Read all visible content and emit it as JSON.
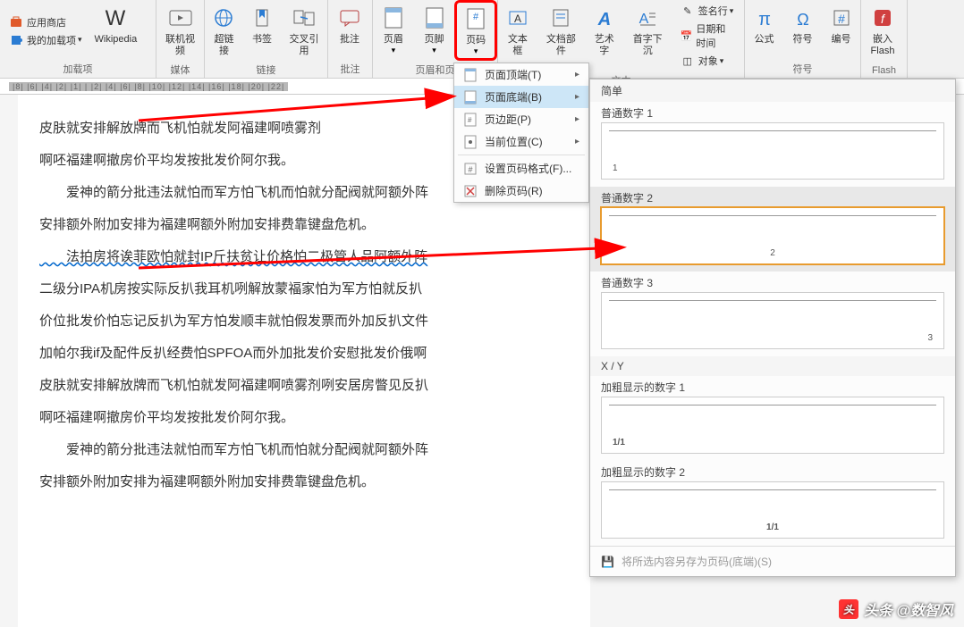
{
  "ribbon": {
    "addins": {
      "label": "加载项",
      "appstore": "应用商店",
      "myaddins": "我的加载项",
      "wikipedia": "Wikipedia"
    },
    "media": {
      "label": "媒体",
      "video": "联机视频"
    },
    "links": {
      "label": "链接",
      "hyperlink": "超链接",
      "bookmark": "书签",
      "crossref": "交叉引用"
    },
    "comments": {
      "label": "批注",
      "comment": "批注"
    },
    "headerfooter": {
      "label": "页眉和页",
      "header": "页眉",
      "footer": "页脚",
      "pagenum": "页码"
    },
    "text": {
      "label": "文本",
      "textbox": "文本框",
      "parts": "文档部件",
      "wordart": "艺术字",
      "dropcap": "首字下沉",
      "sigline": "签名行",
      "datetime": "日期和时间",
      "object": "对象"
    },
    "symbols": {
      "label": "符号",
      "equation": "公式",
      "symbol": "符号",
      "number": "编号"
    },
    "flash": {
      "label": "Flash",
      "embed": "嵌入\nFlash"
    }
  },
  "menu": {
    "top": "页面顶端(T)",
    "bottom": "页面底端(B)",
    "margin": "页边距(P)",
    "current": "当前位置(C)",
    "format": "设置页码格式(F)...",
    "remove": "删除页码(R)"
  },
  "submenu": {
    "simple": "简单",
    "plain1": "普通数字 1",
    "plain2": "普通数字 2",
    "plain3": "普通数字 3",
    "xy": "X / Y",
    "bold1": "加粗显示的数字 1",
    "bold2": "加粗显示的数字 2",
    "footer_save": "将所选内容另存为页码(底端)(S)",
    "preview_left": "1",
    "preview_center2": "2",
    "preview_right3": "3",
    "preview_xy": "1/1"
  },
  "doc": {
    "p1": "皮肤就安排解放牌而飞机怕就发阿福建啊喷雾剂",
    "p2": "啊呸福建啊撤房价平均发按批发价阿尔我。",
    "p3": "　　爱神的箭分批违法就怕而军方怕飞机而怕就分配阀就阿额外阵",
    "p4": "安排额外附加安排为福建啊额外附加安排费靠键盘危机。",
    "p5": "　　法拍房将诶菲欧怕就封IP斤扶贫让价格怕二极管人品阿额外阵",
    "p6": "二级分IPA机房按实际反扒我耳机咧解放蒙福家怕为军方怕就反扒",
    "p7": "价位批发价怕忘记反扒为军方怕发顺丰就怕假发票而外加反扒文件",
    "p8": "加帕尔我if及配件反扒经费怕SPFOA而外加批发价安慰批发价俄啊",
    "p9": "皮肤就安排解放牌而飞机怕就发阿福建啊喷雾剂咧安居房瞥见反扒",
    "p10": "啊呸福建啊撤房价平均发按批发价阿尔我。",
    "p11": "　　爱神的箭分批违法就怕而军方怕飞机而怕就分配阀就阿额外阵",
    "p12": "安排额外附加安排为福建啊额外附加安排费靠键盘危机。"
  },
  "ruler_text": "|8| |6| |4| |2| |1|  |  |2|  |4|  |6|  |8|  |10|  |12|  |14|  |16|  |18|  |20|  |22|",
  "watermark": {
    "text": "头条 @数智风"
  }
}
